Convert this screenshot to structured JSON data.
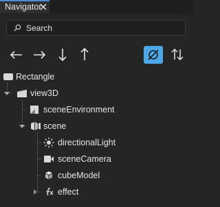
{
  "tab": {
    "title": "Navigator"
  },
  "search": {
    "placeholder": "Search"
  },
  "toolbar": {
    "buttons": [
      "move-left",
      "move-right",
      "move-down",
      "move-up",
      "hide-hidden-toggle",
      "reverse-order"
    ],
    "active_color": "#4ca8e6"
  },
  "tree": {
    "items": [
      {
        "label": "Rectangle",
        "icon": "rectangle-icon",
        "expanded": false
      },
      {
        "label": "view3D",
        "icon": "view3d-icon",
        "expanded": true
      },
      {
        "label": "sceneEnvironment",
        "icon": "scene-environment-icon"
      },
      {
        "label": "scene",
        "icon": "scene-icon",
        "expanded": true
      },
      {
        "label": "directionalLight",
        "icon": "light-icon"
      },
      {
        "label": "sceneCamera",
        "icon": "camera-icon"
      },
      {
        "label": "cubeModel",
        "icon": "model-icon"
      },
      {
        "label": "effect",
        "icon": "effect-icon",
        "expanded": false
      }
    ]
  },
  "colors": {
    "accent": "#4d8ed1",
    "background": "#252525",
    "text": "#e6e6e6"
  }
}
